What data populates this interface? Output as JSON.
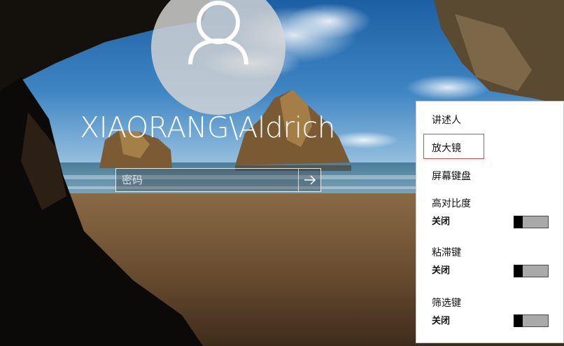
{
  "login": {
    "avatar_icon": "user-silhouette-icon",
    "username": "XIAORANG\\Aldrich",
    "password_placeholder": "密码",
    "submit_icon": "arrow-right-icon"
  },
  "ease_of_access_menu": {
    "items": [
      {
        "label": "讲述人",
        "focused": false
      },
      {
        "label": "放大镜",
        "focused": true
      },
      {
        "label": "屏幕键盘",
        "focused": false
      }
    ],
    "toggles": [
      {
        "label": "高对比度",
        "state": "关闭",
        "on": false
      },
      {
        "label": "粘滞键",
        "state": "关闭",
        "on": false
      },
      {
        "label": "筛选键",
        "state": "关闭",
        "on": false
      }
    ]
  },
  "colors": {
    "menu_background": "#ffffff",
    "focus_outline": "#d24a4a",
    "toggle_track": "#a9a9a9",
    "toggle_knob": "#000000",
    "login_text": "#ffffff"
  }
}
